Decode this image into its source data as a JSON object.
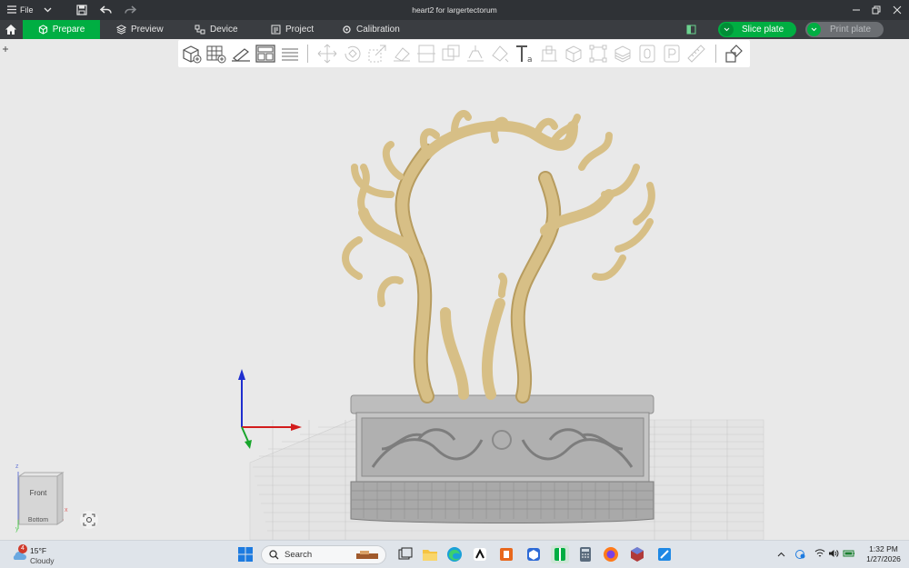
{
  "titlebar": {
    "file_label": "File",
    "window_title": "heart2 for largertectorum"
  },
  "tabs": [
    {
      "label": "Prepare",
      "icon": "cube-icon",
      "active": true
    },
    {
      "label": "Preview",
      "icon": "layers-icon",
      "active": false
    },
    {
      "label": "Device",
      "icon": "device-icon",
      "active": false
    },
    {
      "label": "Project",
      "icon": "project-icon",
      "active": false
    },
    {
      "label": "Calibration",
      "icon": "calibration-icon",
      "active": false
    }
  ],
  "actions": {
    "slice_label": "Slice plate",
    "print_label": "Print plate",
    "accent": "#00ae42"
  },
  "toolbar_icons": [
    "add-object-icon",
    "add-plate-icon",
    "auto-orient-icon",
    "arrange-icon",
    "split-layers-icon",
    "move-icon",
    "rotate-icon",
    "scale-icon",
    "lay-on-face-icon",
    "cut-icon",
    "boolean-icon",
    "support-paint-icon",
    "color-paint-icon",
    "text-icon",
    "emboss-icon",
    "assembly-icon",
    "measure-frame-icon",
    "variable-layer-icon",
    "seam-icon",
    "mmu-icon",
    "ruler-icon",
    "assemble-view-icon"
  ],
  "viewcube": {
    "face_label": "Front",
    "bottom_label": "Bottom",
    "axis_x": "x",
    "axis_y": "y",
    "axis_z": "z"
  },
  "model": {
    "color": "#d7bf86",
    "base_color": "#b9b9b9"
  },
  "taskbar": {
    "weather_temp": "15°F",
    "weather_desc": "Cloudy",
    "weather_badge": "4",
    "search_label": "Search",
    "time": "1:32 PM",
    "date": "1/27/2026"
  }
}
